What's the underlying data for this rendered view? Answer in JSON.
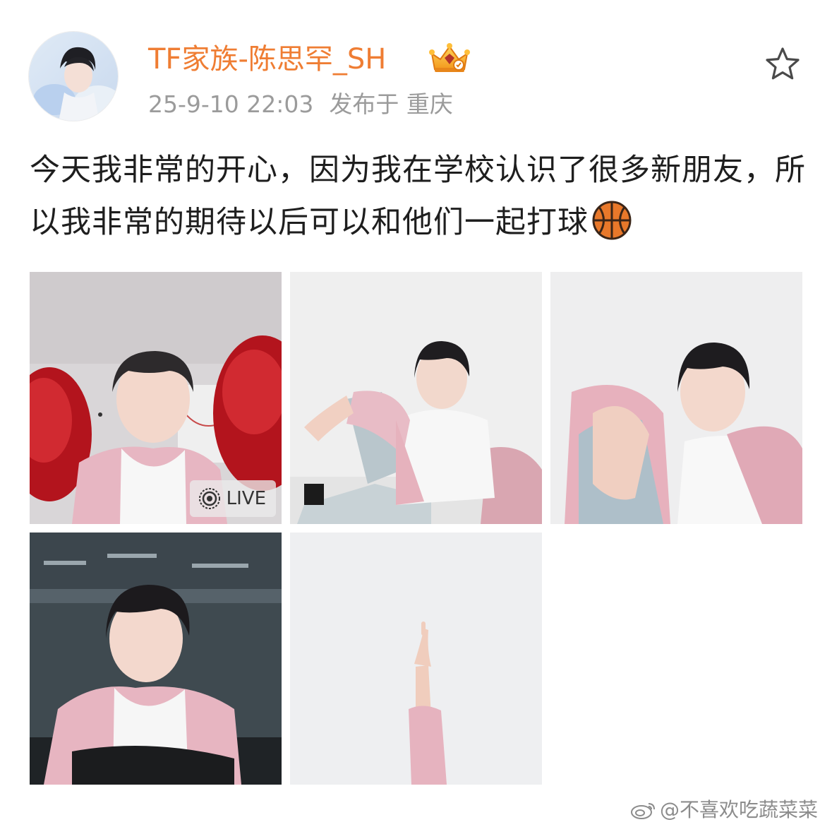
{
  "post": {
    "author": {
      "name": "TF家族-陈思罕_SH",
      "badge_icon": "crown-icon",
      "avatar": "avatar-image"
    },
    "timestamp": "25-9-10 22:03",
    "location_prefix": "发布于",
    "location": "重庆",
    "favorite_icon": "star-icon",
    "text": "今天我非常的开心，因为我在学校认识了很多新朋友，所以我非常的期待以后可以和他们一起打球",
    "emoji": "basketball-emoji",
    "photos": [
      {
        "id": "photo-1",
        "badge": "LIVE",
        "badge_icon": "live-icon"
      },
      {
        "id": "photo-2"
      },
      {
        "id": "photo-3"
      },
      {
        "id": "photo-4"
      },
      {
        "id": "photo-5"
      }
    ]
  },
  "watermark": {
    "text": "@不喜欢吃蔬菜菜",
    "icon": "weibo-logo-icon"
  },
  "colors": {
    "username": "#ef7d33",
    "meta": "#9b9b9b",
    "text": "#1e1e1e",
    "watermark": "#8c8c8c"
  }
}
